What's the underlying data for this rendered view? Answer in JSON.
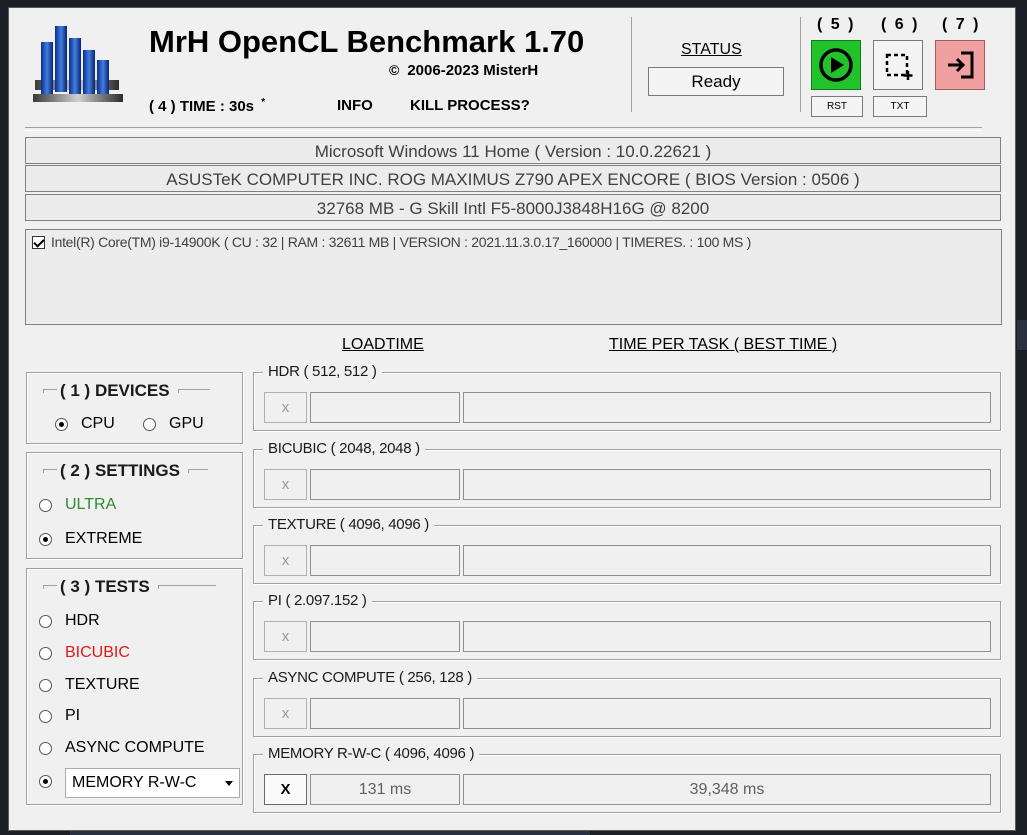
{
  "app": {
    "title": "MrH OpenCL Benchmark 1.70",
    "copyright_symbol": "©",
    "copyright": "2006-2023 MisterH"
  },
  "menu": {
    "time": "( 4 ) TIME : 30s",
    "time_mark": "*",
    "info": "INFO",
    "kill": "KILL PROCESS?"
  },
  "status": {
    "label": "STATUS",
    "value": "Ready"
  },
  "toolbar": {
    "btn5_num": "( 5 )",
    "btn6_num": "( 6 )",
    "btn7_num": "( 7 )",
    "rst_label": "RST",
    "txt_label": "TXT",
    "colors": {
      "run": "#22c32a",
      "exit": "#f0a0a0"
    }
  },
  "system": {
    "os": "Microsoft Windows 11 Home ( Version : 10.0.22621 )",
    "board": "ASUSTeK COMPUTER INC. ROG MAXIMUS Z790 APEX ENCORE ( BIOS Version : 0506 )",
    "memory": "32768 MB - G Skill Intl F5-8000J3848H16G    @ 8200"
  },
  "device_list": [
    {
      "checked": true,
      "label": "Intel(R) Core(TM) i9-14900K ( CU : 32 | RAM : 32611 MB | VERSION : 2021.11.3.0.17_160000 | TIMERES. : 100 MS )"
    }
  ],
  "columns": {
    "loadtime": "LOADTIME",
    "time_per_task": "TIME PER TASK ( BEST TIME )"
  },
  "devices": {
    "title": "( 1 ) DEVICES",
    "cpu": "CPU",
    "gpu": "GPU",
    "selected": "CPU"
  },
  "settings": {
    "title": "( 2 ) SETTINGS",
    "ultra": "ULTRA",
    "extreme": "EXTREME",
    "selected": "EXTREME",
    "colors": {
      "ultra": "#2e8b2e"
    }
  },
  "tests": {
    "title": "( 3 ) TESTS",
    "items": [
      "HDR",
      "BICUBIC",
      "TEXTURE",
      "PI",
      "ASYNC COMPUTE"
    ],
    "combo_value": "MEMORY R-W-C",
    "selected": "MEMORY R-W-C",
    "colors": {
      "bicubic": "#e01818"
    }
  },
  "results": [
    {
      "label": "HDR ( 512, 512 )",
      "x": "x",
      "loadtime": "",
      "time": "",
      "active": false
    },
    {
      "label": "BICUBIC ( 2048, 2048 )",
      "x": "x",
      "loadtime": "",
      "time": "",
      "active": false
    },
    {
      "label": "TEXTURE ( 4096, 4096 )",
      "x": "x",
      "loadtime": "",
      "time": "",
      "active": false
    },
    {
      "label": "PI ( 2.097.152 )",
      "x": "x",
      "loadtime": "",
      "time": "",
      "active": false
    },
    {
      "label": "ASYNC COMPUTE ( 256, 128 )",
      "x": "x",
      "loadtime": "",
      "time": "",
      "active": false
    },
    {
      "label": "MEMORY R-W-C ( 4096, 4096 )",
      "x": "X",
      "loadtime": "131 ms",
      "time": "39,348 ms",
      "active": true
    }
  ]
}
